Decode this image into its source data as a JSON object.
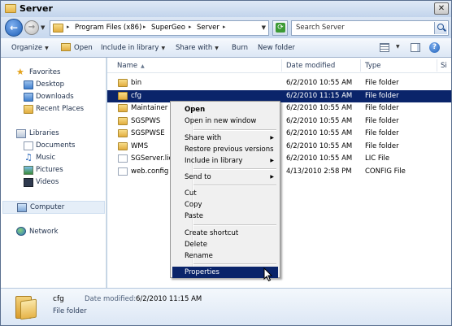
{
  "window": {
    "title": "Server"
  },
  "address": {
    "crumbs": [
      "Program Files (x86)",
      "SuperGeo",
      "Server"
    ],
    "search_placeholder": "Search Server"
  },
  "toolbar": {
    "organize": "Organize",
    "open": "Open",
    "include": "Include in library",
    "share": "Share with",
    "burn": "Burn",
    "new_folder": "New folder"
  },
  "nav": {
    "favorites": "Favorites",
    "desktop": "Desktop",
    "downloads": "Downloads",
    "recent": "Recent Places",
    "libraries": "Libraries",
    "documents": "Documents",
    "music": "Music",
    "pictures": "Pictures",
    "videos": "Videos",
    "computer": "Computer",
    "network": "Network"
  },
  "columns": {
    "name": "Name",
    "date": "Date modified",
    "type": "Type",
    "size": "Si"
  },
  "files": [
    {
      "name": "bin",
      "date": "6/2/2010 10:55 AM",
      "type": "File folder",
      "kind": "folder"
    },
    {
      "name": "cfg",
      "date": "6/2/2010 11:15 AM",
      "type": "File folder",
      "kind": "folder",
      "selected": true
    },
    {
      "name": "Maintainer",
      "date": "6/2/2010 10:55 AM",
      "type": "File folder",
      "kind": "folder"
    },
    {
      "name": "SGSPWS",
      "date": "6/2/2010 10:55 AM",
      "type": "File folder",
      "kind": "folder"
    },
    {
      "name": "SGSPWSE",
      "date": "6/2/2010 10:55 AM",
      "type": "File folder",
      "kind": "folder"
    },
    {
      "name": "WMS",
      "date": "6/2/2010 10:55 AM",
      "type": "File folder",
      "kind": "folder"
    },
    {
      "name": "SGServer.lic",
      "date": "6/2/2010 10:55 AM",
      "type": "LIC File",
      "kind": "file"
    },
    {
      "name": "web.config",
      "date": "4/13/2010 2:58 PM",
      "type": "CONFIG File",
      "kind": "file"
    }
  ],
  "context_menu": {
    "open": "Open",
    "open_new_window": "Open in new window",
    "share_with": "Share with",
    "restore": "Restore previous versions",
    "include": "Include in library",
    "send_to": "Send to",
    "cut": "Cut",
    "copy": "Copy",
    "paste": "Paste",
    "create_shortcut": "Create shortcut",
    "delete": "Delete",
    "rename": "Rename",
    "properties": "Properties"
  },
  "details": {
    "name": "cfg",
    "type": "File folder",
    "modified_label": "Date modified:",
    "modified_value": "6/2/2010 11:15 AM"
  },
  "icons": {
    "back": "back-arrow-icon",
    "forward": "forward-arrow-icon",
    "refresh": "refresh-icon",
    "search": "search-icon"
  },
  "colors": {
    "selection": "#0a246a",
    "chrome": "#c7d8ee"
  }
}
